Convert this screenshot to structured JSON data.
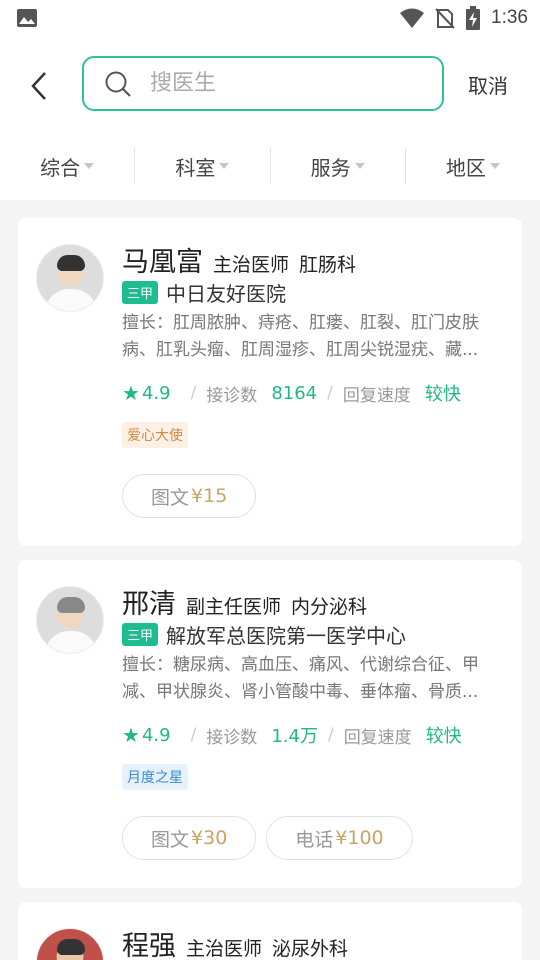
{
  "status_bar": {
    "time": "1:36"
  },
  "search": {
    "placeholder": "搜医生",
    "cancel_label": "取消"
  },
  "filters": [
    "综合",
    "科室",
    "服务",
    "地区"
  ],
  "doctors": [
    {
      "name": "马凰富",
      "title": "主治医师",
      "department": "肛肠科",
      "hospital_grade": "三甲",
      "hospital": "中日友好医院",
      "specialty": "擅长：肛周脓肿、痔疮、肛瘘、肛裂、肛门皮肤病、肛乳头瘤、肛周湿疹、肛周尖锐湿疣、藏...",
      "rating": "4.9",
      "consult_label": "接诊数",
      "consult_count": "8164",
      "reply_label": "回复速度",
      "reply_speed": "较快",
      "tag": "爱心大使",
      "services": [
        {
          "label": "图文",
          "price": "¥15"
        }
      ]
    },
    {
      "name": "邢清",
      "title": "副主任医师",
      "department": "内分泌科",
      "hospital_grade": "三甲",
      "hospital": "解放军总医院第一医学中心",
      "specialty": "擅长：糖尿病、高血压、痛风、代谢综合征、甲减、甲状腺炎、肾小管酸中毒、垂体瘤、骨质...",
      "rating": "4.9",
      "consult_label": "接诊数",
      "consult_count": "1.4万",
      "reply_label": "回复速度",
      "reply_speed": "较快",
      "tag": "月度之星",
      "services": [
        {
          "label": "图文",
          "price": "¥30"
        },
        {
          "label": "电话",
          "price": "¥100"
        }
      ]
    },
    {
      "name": "程强",
      "title": "主治医师",
      "department": "泌尿外科"
    }
  ],
  "colors": {
    "accent": "#2ec29a",
    "rating_green": "#20b883",
    "price_gold": "#c9a36a"
  }
}
